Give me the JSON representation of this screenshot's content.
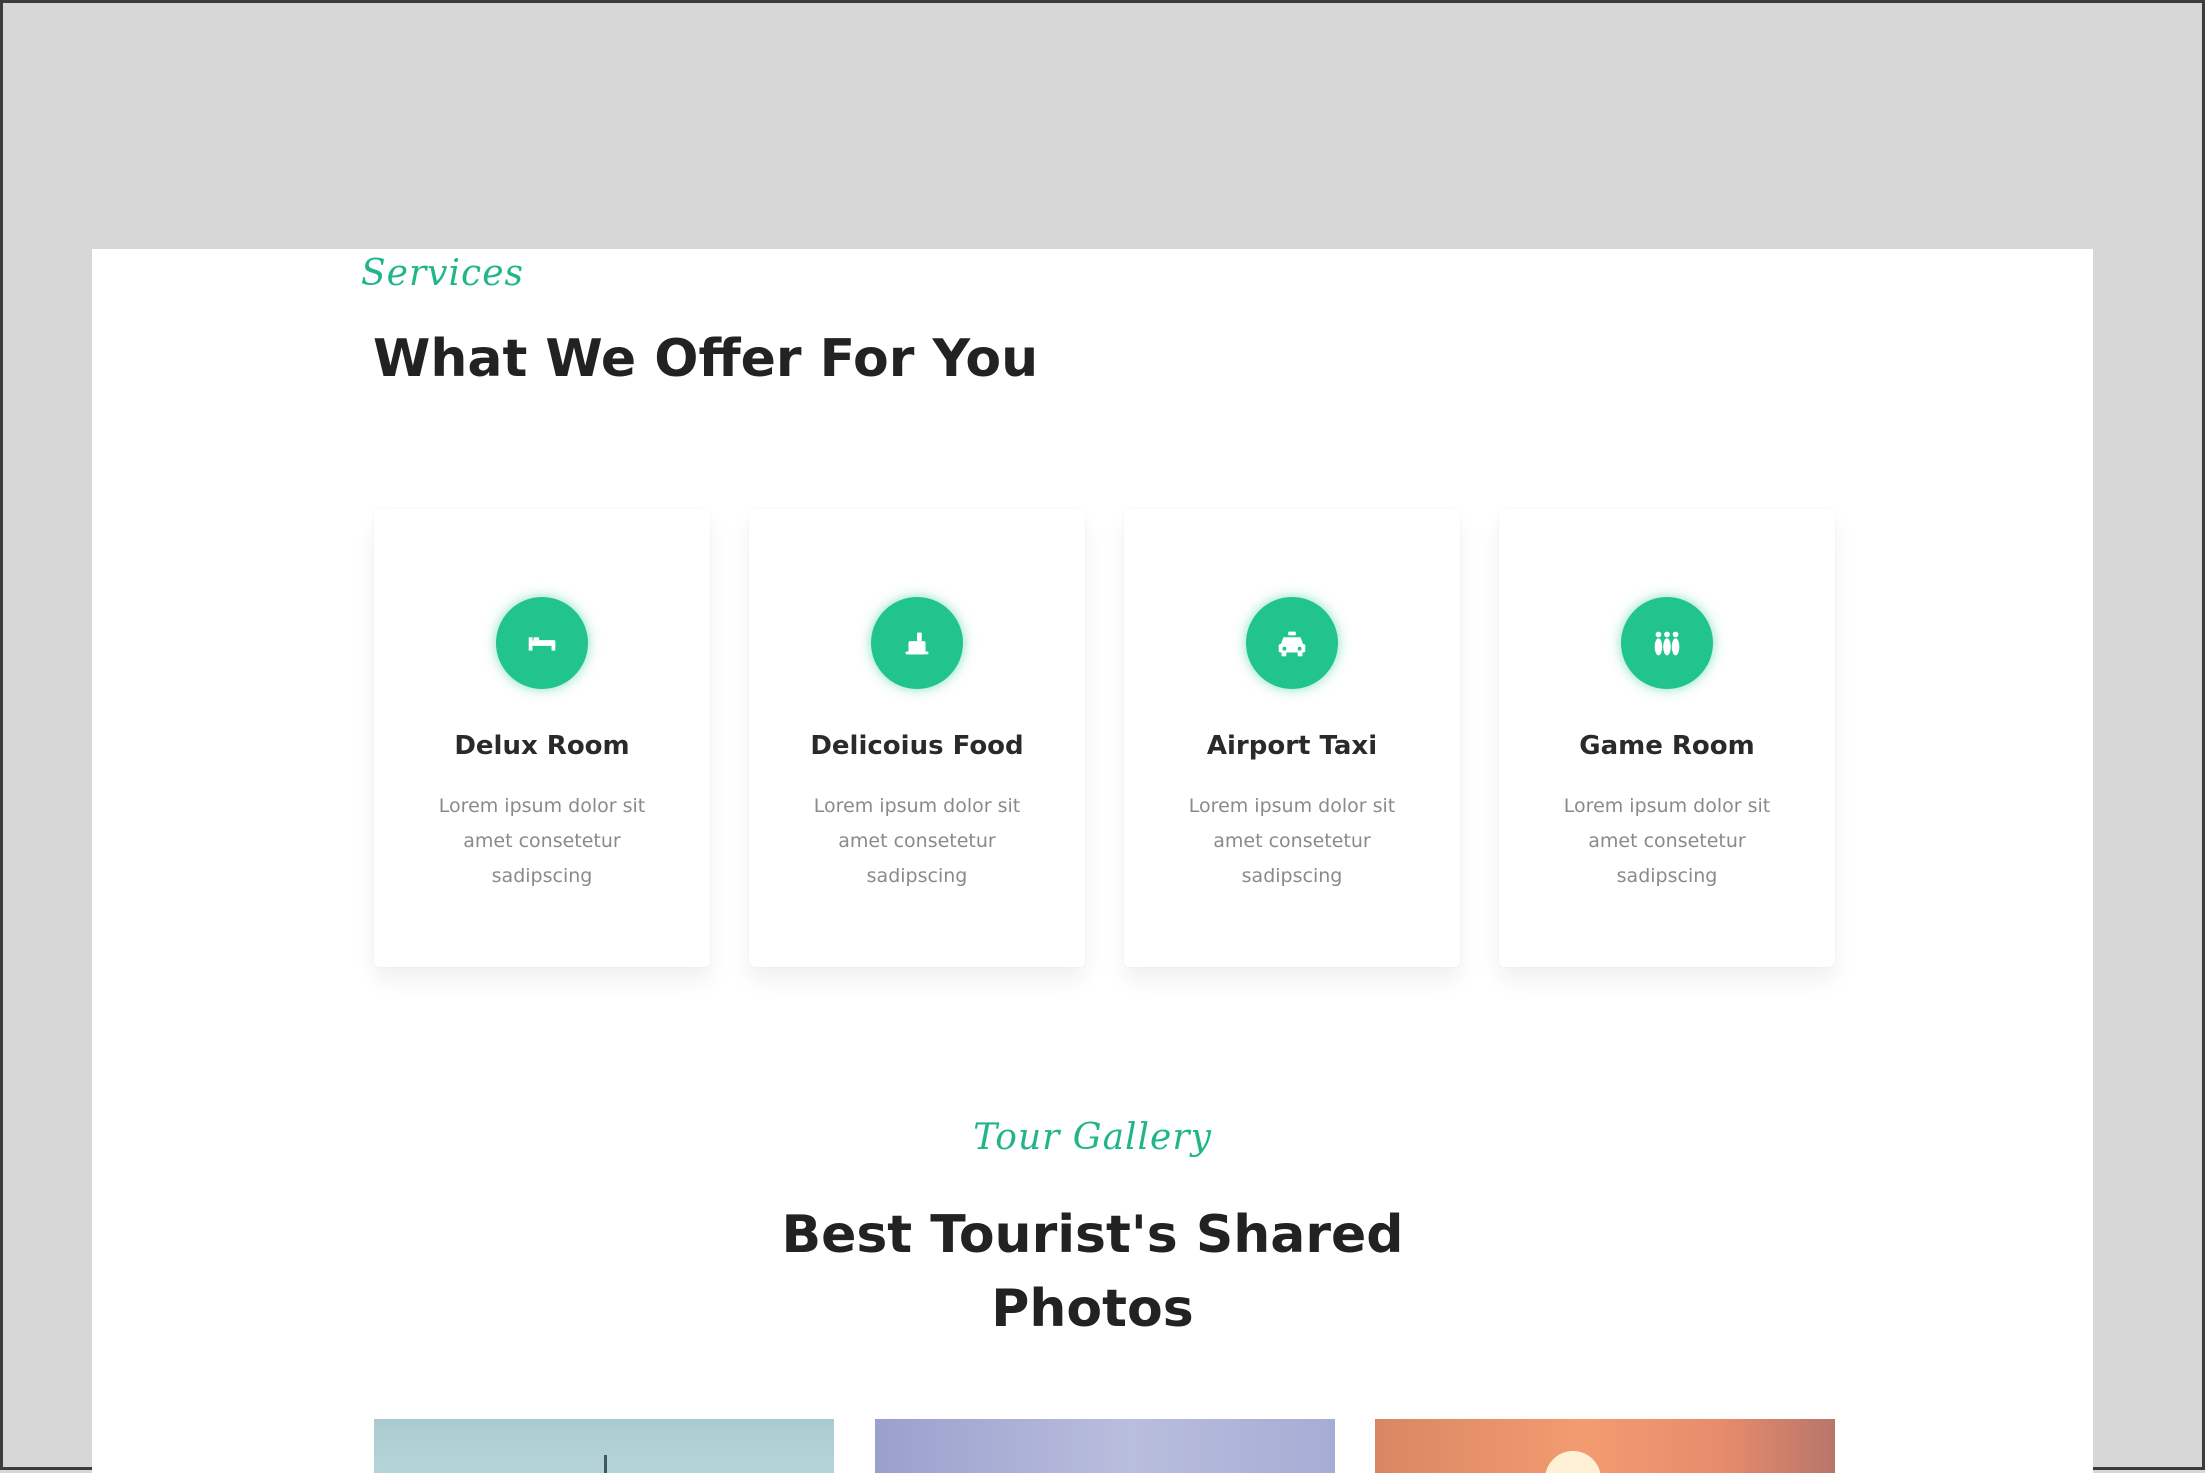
{
  "services": {
    "label": "Services",
    "title": "What We Offer For You",
    "cards": [
      {
        "icon": "bed-icon",
        "title": "Delux Room",
        "text": "Lorem ipsum dolor sit amet consetetur sadipscing"
      },
      {
        "icon": "food-icon",
        "title": "Delicoius Food",
        "text": "Lorem ipsum dolor sit amet consetetur sadipscing"
      },
      {
        "icon": "taxi-icon",
        "title": "Airport Taxi",
        "text": "Lorem ipsum dolor sit amet consetetur sadipscing"
      },
      {
        "icon": "bowling-icon",
        "title": "Game Room",
        "text": "Lorem ipsum dolor sit amet consetetur sadipscing"
      }
    ]
  },
  "gallery": {
    "label": "Tour Gallery",
    "title_line1": "Best Tourist's Shared",
    "title_line2": "Photos"
  },
  "colors": {
    "accent": "#21c48d",
    "heading": "#222222",
    "body_text": "#8a8a8a",
    "backdrop": "#d7d7d7"
  }
}
